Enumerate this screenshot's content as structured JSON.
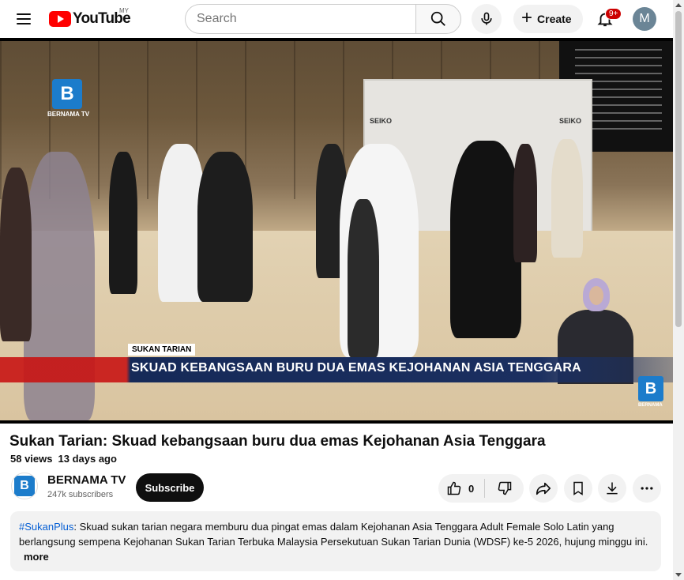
{
  "header": {
    "logo_text": "YouTube",
    "region": "MY",
    "search_placeholder": "Search",
    "create_label": "Create",
    "notification_count": "9+",
    "avatar_letter": "M"
  },
  "video": {
    "overlay_station": "BERNAMA TV",
    "overlay_label": "SUKAN TARIAN",
    "overlay_headline": "SKUAD KEBANGSAAN BURU DUA EMAS KEJOHANAN ASIA TENGGARA",
    "corner_logo": "BERNAMA",
    "banner_text_1": "SEIKO",
    "banner_text_2": "SEIKO"
  },
  "info": {
    "title": "Sukan Tarian: Skuad kebangsaan buru dua emas Kejohanan Asia Tenggara",
    "views": "58 views",
    "date": "13 days ago"
  },
  "channel": {
    "name": "BERNAMA TV",
    "subscribers": "247k subscribers",
    "subscribe_label": "Subscribe"
  },
  "actions": {
    "like_count": "0"
  },
  "description": {
    "hashtag": "#SukanPlus",
    "text": ": Skuad sukan tarian negara memburu dua pingat emas dalam Kejohanan Asia Tenggara Adult Female Solo Latin yang berlangsung sempena Kejohanan Sukan Tarian Terbuka Malaysia Persekutuan Sukan Tarian Dunia (WDSF) ke-5 2026, hujung minggu ini.",
    "more_label": "more"
  }
}
